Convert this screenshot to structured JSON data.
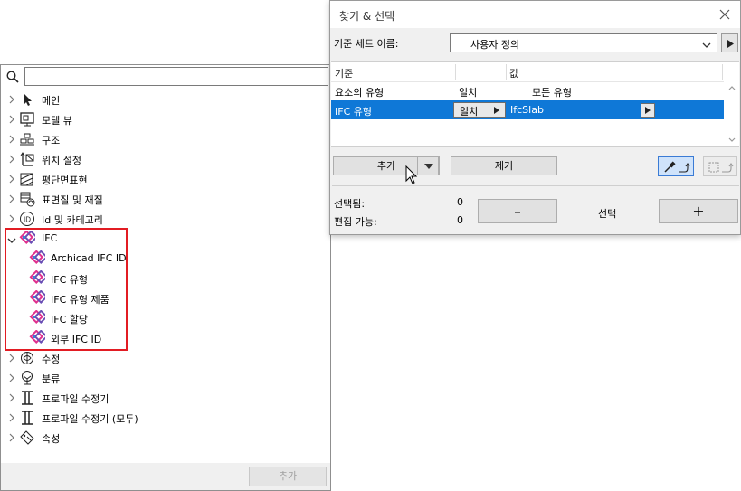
{
  "tree": {
    "search": {
      "value": "",
      "placeholder": ""
    },
    "items": [
      {
        "label": "메인",
        "icon": "arrow-pointer-icon"
      },
      {
        "label": "모델 뷰",
        "icon": "model-view-icon"
      },
      {
        "label": "구조",
        "icon": "structure-icon"
      },
      {
        "label": "위치 설정",
        "icon": "positioning-icon"
      },
      {
        "label": "평단면표현",
        "icon": "floor-plan-icon"
      },
      {
        "label": "표면질 및 재질",
        "icon": "surface-material-icon"
      },
      {
        "label": "Id 및 카테고리",
        "icon": "id-icon"
      },
      {
        "label": "IFC",
        "icon": "ifc-icon"
      },
      {
        "label": "Archicad IFC ID",
        "icon": "ifc-icon"
      },
      {
        "label": "IFC 유형",
        "icon": "ifc-icon"
      },
      {
        "label": "IFC 유형 제품",
        "icon": "ifc-icon"
      },
      {
        "label": "IFC 할당",
        "icon": "ifc-icon"
      },
      {
        "label": "외부 IFC ID",
        "icon": "ifc-icon"
      },
      {
        "label": "수정",
        "icon": "modify-icon"
      },
      {
        "label": "분류",
        "icon": "classification-icon"
      },
      {
        "label": "프로파일 수정기",
        "icon": "profile-modifier-icon"
      },
      {
        "label": "프로파일 수정기 (모두)",
        "icon": "profile-modifier-icon"
      },
      {
        "label": "속성",
        "icon": "property-icon"
      }
    ],
    "add_label": "추가"
  },
  "dialog": {
    "title": "찾기 & 선택",
    "criteria_set_label": "기준 세트 이름:",
    "criteria_set_value": "사용자 정의",
    "table": {
      "headers": [
        "기준",
        "",
        "값"
      ],
      "rows": [
        {
          "criterion": "요소의 유형",
          "match": "일치",
          "value": "모든 유형",
          "selected": false
        },
        {
          "criterion": "IFC 유형",
          "match": "일치",
          "value": "IfcSlab",
          "selected": true
        }
      ]
    },
    "add_label": "추가",
    "remove_label": "제거",
    "selected_label": "선택됨:",
    "selected_count": "0",
    "editable_label": "편집 가능:",
    "editable_count": "0",
    "minus_label": "–",
    "plus_label": "+",
    "select_label": "선택"
  },
  "colors": {
    "selection": "#0f78d7",
    "highlight_border": "#e21c23",
    "ifc_icon_pink": "#e0318e",
    "ifc_icon_purple": "#6b4fb5"
  }
}
